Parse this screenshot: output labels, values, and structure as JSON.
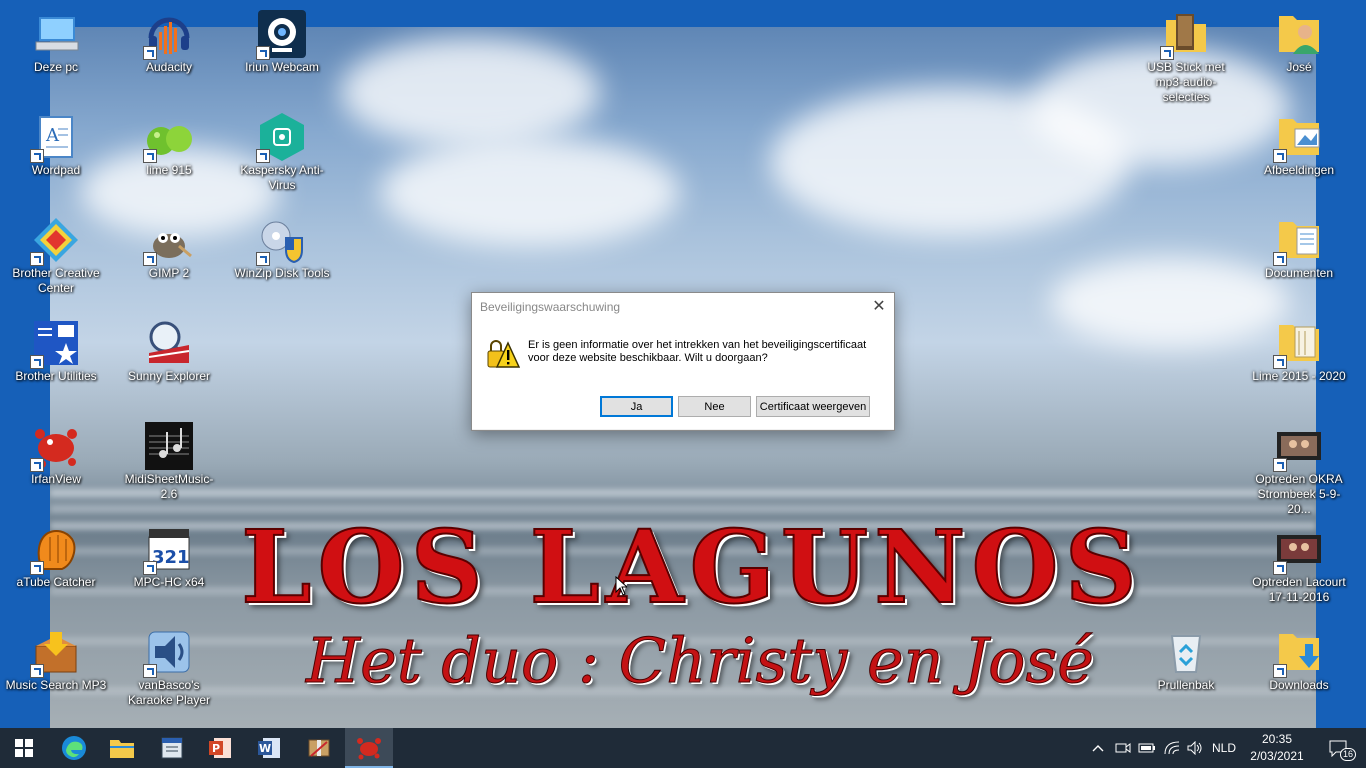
{
  "desktop": {
    "poster_title": "LOS LAGUNOS",
    "poster_subtitle": "Het duo : Christy en José",
    "icons": [
      {
        "label": "Deze pc",
        "icon": "computer-icon"
      },
      {
        "label": "Audacity",
        "icon": "audacity-icon"
      },
      {
        "label": "Iriun Webcam",
        "icon": "webcam-icon"
      },
      {
        "label": "Wordpad",
        "icon": "wordpad-icon"
      },
      {
        "label": "lime 915",
        "icon": "lime-icon"
      },
      {
        "label": "Kaspersky Anti-Virus",
        "icon": "kaspersky-icon"
      },
      {
        "label": "Brother Creative Center",
        "icon": "brother-creative-icon"
      },
      {
        "label": "GIMP 2",
        "icon": "gimp-icon"
      },
      {
        "label": "WinZip Disk Tools",
        "icon": "winzip-icon"
      },
      {
        "label": "Brother Utilities",
        "icon": "brother-utilities-icon"
      },
      {
        "label": "Sunny Explorer",
        "icon": "sunny-explorer-icon"
      },
      {
        "label": "IrfanView",
        "icon": "irfanview-icon"
      },
      {
        "label": "MidiSheetMusic-2.6",
        "icon": "midi-sheet-icon"
      },
      {
        "label": "aTube Catcher",
        "icon": "atube-icon"
      },
      {
        "label": "MPC-HC x64",
        "icon": "mpc-hc-icon"
      },
      {
        "label": "Music Search MP3",
        "icon": "music-search-icon"
      },
      {
        "label": "vanBasco's Karaoke Player",
        "icon": "karaoke-icon"
      },
      {
        "label": "USB Stick met mp3-audio-selecties",
        "icon": "folder-icon"
      },
      {
        "label": "José",
        "icon": "user-folder-icon"
      },
      {
        "label": "Afbeeldingen",
        "icon": "pictures-folder-icon"
      },
      {
        "label": "Documenten",
        "icon": "documents-folder-icon"
      },
      {
        "label": "Lime 2015 - 2020",
        "icon": "folder-icon"
      },
      {
        "label": "Optreden OKRA Strombeek 5-9-20...",
        "icon": "video-icon"
      },
      {
        "label": "Optreden Lacourt 17-11-2016",
        "icon": "video-icon"
      },
      {
        "label": "Prullenbak",
        "icon": "recycle-bin-icon"
      },
      {
        "label": "Downloads",
        "icon": "downloads-folder-icon"
      }
    ]
  },
  "dialog": {
    "title": "Beveiligingswaarschuwing",
    "close_glyph": "✕",
    "message": "Er is geen informatie over het intrekken van het beveiligingscertificaat voor deze website beschikbaar. Wilt u doorgaan?",
    "buttons": {
      "yes": "Ja",
      "no": "Nee",
      "certificate": "Certificaat weergeven"
    }
  },
  "taskbar": {
    "pinned": [
      "start-icon",
      "edge-icon",
      "file-explorer-icon",
      "app-icon",
      "powerpoint-icon",
      "word-icon",
      "winzip-icon",
      "irfanview-icon"
    ],
    "tray": {
      "language": "NLD",
      "time": "20:35",
      "date": "2/03/2021",
      "notification_count": "16"
    }
  }
}
